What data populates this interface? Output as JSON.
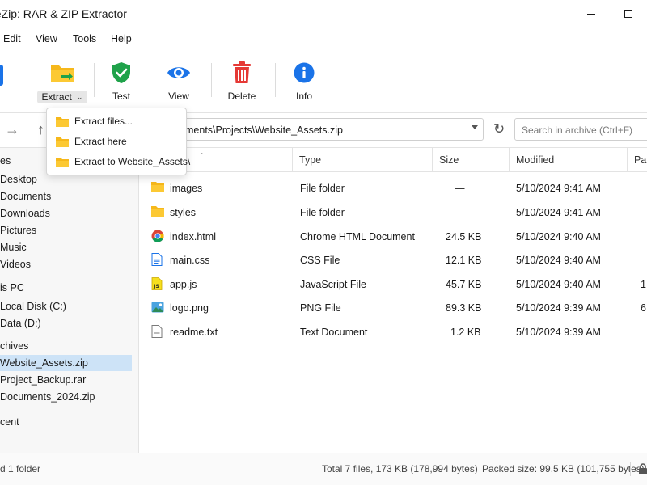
{
  "window": {
    "title": "eeZip: RAR & ZIP Extractor"
  },
  "menu": [
    "Edit",
    "View",
    "Tools",
    "Help"
  ],
  "toolbar": {
    "extract": "Extract",
    "test": "Test",
    "view": "View",
    "delete": "Delete",
    "info": "Info"
  },
  "extract_menu": [
    "Extract files...",
    "Extract here",
    "Extract to Website_Assets\\"
  ],
  "address": {
    "path": "ments\\Projects\\Website_Assets.zip"
  },
  "search": {
    "placeholder": "Search in archive  (Ctrl+F)"
  },
  "sidebar": {
    "items": [
      "es",
      "Desktop",
      "Documents",
      "Downloads",
      "Pictures",
      "Music",
      "Videos",
      "is PC",
      "Local Disk (C:)",
      "Data (D:)",
      "chives",
      "Website_Assets.zip",
      "Project_Backup.rar",
      "Documents_2024.zip",
      "cent"
    ],
    "selected": "Website_Assets.zip"
  },
  "columns": {
    "type": "Type",
    "size": "Size",
    "modified": "Modified",
    "packed": "Pa"
  },
  "files": [
    {
      "name": "images",
      "type": "File folder",
      "size": "—",
      "modified": "5/10/2024 9:41 AM",
      "packed": "",
      "icon": "folder-icon"
    },
    {
      "name": "styles",
      "type": "File folder",
      "size": "—",
      "modified": "5/10/2024 9:41 AM",
      "packed": "",
      "icon": "folder-icon"
    },
    {
      "name": "index.html",
      "type": "Chrome HTML Document",
      "size": "24.5 KB",
      "modified": "5/10/2024 9:40 AM",
      "packed": "",
      "icon": "chrome-icon"
    },
    {
      "name": "main.css",
      "type": "CSS File",
      "size": "12.1 KB",
      "modified": "5/10/2024 9:40 AM",
      "packed": "",
      "icon": "css-file-icon"
    },
    {
      "name": "app.js",
      "type": "JavaScript File",
      "size": "45.7 KB",
      "modified": "5/10/2024 9:40 AM",
      "packed": "1",
      "icon": "js-file-icon"
    },
    {
      "name": "logo.png",
      "type": "PNG File",
      "size": "89.3 KB",
      "modified": "5/10/2024 9:39 AM",
      "packed": "6",
      "icon": "image-file-icon"
    },
    {
      "name": "readme.txt",
      "type": "Text Document",
      "size": "1.2 KB",
      "modified": "5/10/2024 9:39 AM",
      "packed": "",
      "icon": "text-file-icon"
    }
  ],
  "status": {
    "selection": "d 1 folder",
    "total": "Total 7 files, 173 KB (178,994 bytes)",
    "packed": "Packed size: 99.5 KB (101,755 bytes)"
  },
  "colors": {
    "accent": "#1a73e8",
    "selection": "#cde3f7",
    "folder": "#f6b81b",
    "delete": "#e53935",
    "test": "#1fa24a"
  }
}
